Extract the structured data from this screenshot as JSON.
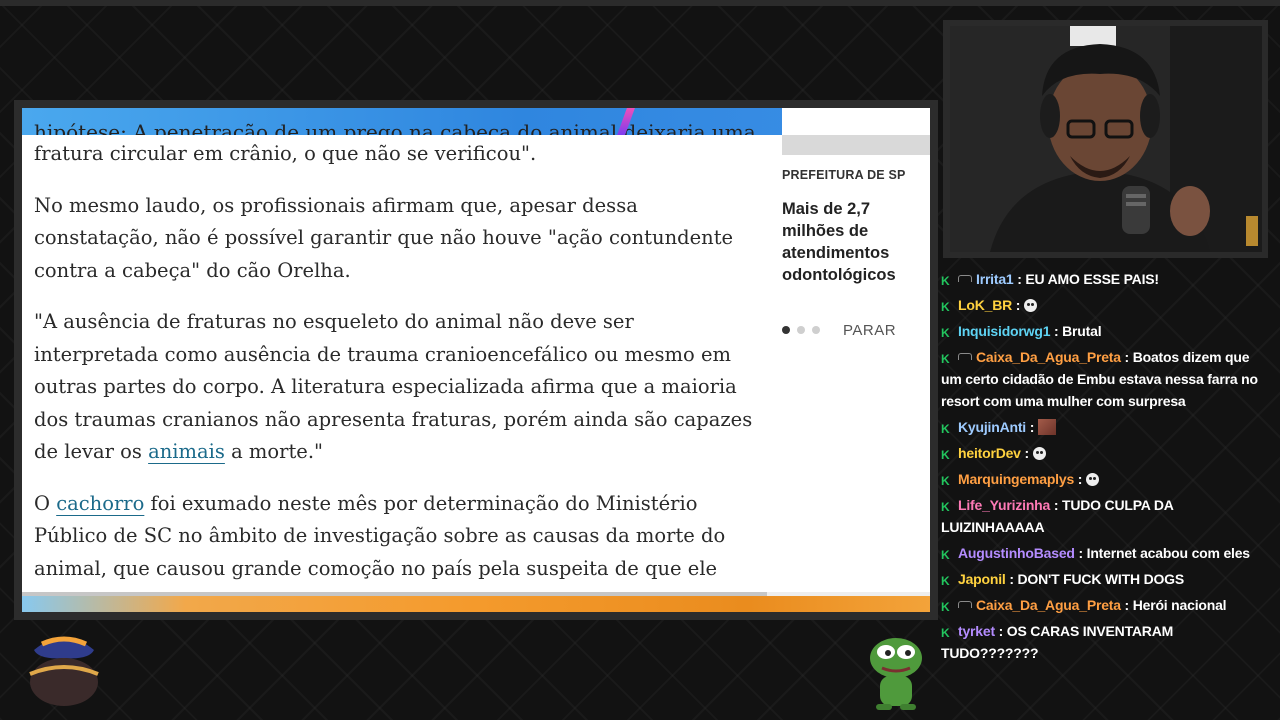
{
  "article": {
    "top_cut_text": "hipótese: A penetração de um prego na cabeça do animal deixaria uma",
    "p1": "fratura circular em crânio, o que não se verificou\".",
    "p2": "No mesmo laudo, os profissionais afirmam que, apesar dessa constatação, não é possível garantir que não houve \"ação contundente contra a cabeça\" do cão Orelha.",
    "p3_before": "\"A ausência de fraturas no esqueleto do animal não deve ser interpretada como ausência de trauma cranioencefálico ou mesmo em outras partes do corpo. A literatura especializada afirma que a maioria dos traumas cranianos não apresenta fraturas, porém ainda são capazes de levar os ",
    "p3_link": "animais",
    "p3_after": " a morte.\"",
    "p4_before": "O ",
    "p4_link": "cachorro",
    "p4_after": " foi exumado neste mês por determinação do Ministério Público de SC no âmbito de investigação sobre as causas da morte do animal, que causou grande comoção no país pela suspeita de que ele tenha sido"
  },
  "sidebar": {
    "kicker": "PREFEITURA DE SP",
    "title": "Mais de 2,7 milhões de atendimentos odontológicos",
    "stop_label": "PARAR"
  },
  "chat": {
    "messages": [
      {
        "user": "Irrita1",
        "color": "#9ecbff",
        "text": ": EU AMO ESSE PAIS!",
        "extra_badge": true,
        "emote": null
      },
      {
        "user": "LoK_BR",
        "color": "#ffd23f",
        "text": ":",
        "extra_badge": false,
        "emote": "skull"
      },
      {
        "user": "Inquisidorwg1",
        "color": "#5ed3f3",
        "text": ": Brutal",
        "extra_badge": false,
        "emote": null
      },
      {
        "user": "Caixa_Da_Agua_Preta",
        "color": "#ff9f43",
        "text": ": Boatos dizem que um certo cidadão de Embu estava nessa farra no resort com uma mulher com surpresa",
        "extra_badge": true,
        "emote": null
      },
      {
        "user": "KyujinAnti",
        "color": "#9ecbff",
        "text": ":",
        "extra_badge": false,
        "emote": "image"
      },
      {
        "user": "heitorDev",
        "color": "#ffd23f",
        "text": ":",
        "extra_badge": false,
        "emote": "skull"
      },
      {
        "user": "Marquingemaplys",
        "color": "#ff9f43",
        "text": ":",
        "extra_badge": false,
        "emote": "skull"
      },
      {
        "user": "Life_Yurizinha",
        "color": "#ff7ab6",
        "text": ": TUDO CULPA DA LUIZINHAAAAA",
        "extra_badge": false,
        "emote": null
      },
      {
        "user": "AugustinhoBased",
        "color": "#b48cff",
        "text": ": Internet acabou com eles",
        "extra_badge": false,
        "emote": null
      },
      {
        "user": "Japonil",
        "color": "#ffd23f",
        "text": ": DON'T FUCK WITH DOGS",
        "extra_badge": false,
        "emote": null
      },
      {
        "user": "Caixa_Da_Agua_Preta",
        "color": "#ff9f43",
        "text": ": Herói nacional",
        "extra_badge": true,
        "emote": null
      },
      {
        "user": "tyrket",
        "color": "#b48cff",
        "text": ": OS CARAS INVENTARAM TUDO???????",
        "extra_badge": false,
        "emote": null
      }
    ]
  }
}
